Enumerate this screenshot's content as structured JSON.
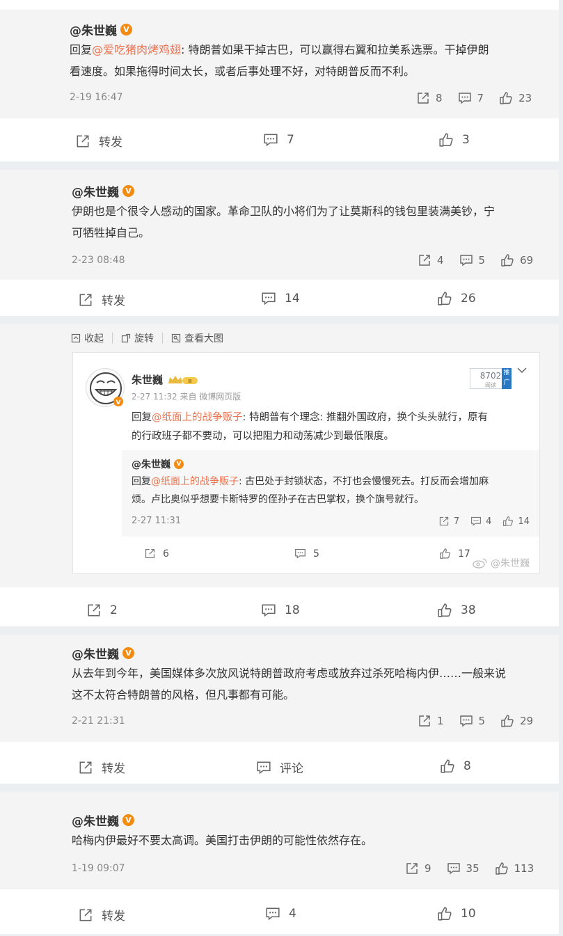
{
  "comments": [
    {
      "author": "@朱世巍",
      "reply_prefix": "回复",
      "mention": "@爱吃猪肉烤鸡翅",
      "text_line1_after_mention": ": 特朗普如果干掉古巴，可以赢得右翼和拉美系选票。干掉伊朗",
      "text_line2": "看速度。如果拖得时间太长，或者后事处理不好，对特朗普反而不利。",
      "time": "2-19 16:47",
      "reposts": "8",
      "comments": "7",
      "likes": "23"
    },
    {
      "author": "@朱世巍",
      "text_line1": "伊朗也是个很令人感动的国家。革命卫队的小将们为了让莫斯科的钱包里装满美钞，宁",
      "text_line2": "可牺牲掉自己。",
      "time": "2-23 08:48",
      "reposts": "4",
      "comments": "5",
      "likes": "69"
    },
    {
      "author": "@朱世巍",
      "text_line1": "从去年到今年，美国媒体多次放风说特朗普政府考虑或放弃过杀死哈梅内伊……一般来说",
      "text_line2": "这不太符合特朗普的风格，但凡事都有可能。",
      "time": "2-21 21:31",
      "reposts": "1",
      "comments": "5",
      "likes": "29"
    },
    {
      "author": "@朱世巍",
      "text_line1": "哈梅内伊最好不要太高调。美国打击伊朗的可能性依然存在。",
      "time": "1-19 09:07",
      "reposts": "9",
      "comments": "35",
      "likes": "113"
    }
  ],
  "action_bars": [
    {
      "repost": "转发",
      "comment": "7",
      "like": "3"
    },
    {
      "repost": "转发",
      "comment": "14",
      "like": "26"
    },
    {
      "repost": "2",
      "comment": "18",
      "like": "38"
    },
    {
      "repost": "转发",
      "comment": "评论",
      "like": "8"
    },
    {
      "repost": "转发",
      "comment": "4",
      "like": "10"
    }
  ],
  "image_toolbar": {
    "collapse": "收起",
    "rotate": "旋转",
    "view_large": "查看大图"
  },
  "embed": {
    "name": "朱世巍",
    "meta": "2-27 11:32 来自 微博网页版",
    "reply_prefix": "回复",
    "mention": "@纸面上的战争贩子",
    "text_after_mention": ": 特朗普有个理念: 推翻外国政府，换个头头就行，原有",
    "text_line2": "的行政班子都不要动，可以把阻力和动荡减少到最低限度。",
    "badge_number": "8702",
    "badge_sub": "阅读",
    "badge_tag": "推广",
    "inner": {
      "author": "@朱世巍",
      "reply_prefix": "回复",
      "mention": "@纸面上的战争贩子",
      "text_after_mention": ": 古巴处于封锁状态，不打也会慢慢死去。打反而会增加麻",
      "text_line2": "烦。卢比奥似乎想要卡斯特罗的侄孙子在古巴掌权，换个旗号就行。",
      "time": "2-27 11:31",
      "reposts": "7",
      "comments": "4",
      "likes": "14"
    },
    "actions": {
      "repost": "6",
      "comment": "5",
      "like": "17"
    },
    "watermark": "@朱世巍"
  },
  "colors": {
    "mention": "#eb7350",
    "vbadge": "#f38b13",
    "background": "#eceff1"
  }
}
